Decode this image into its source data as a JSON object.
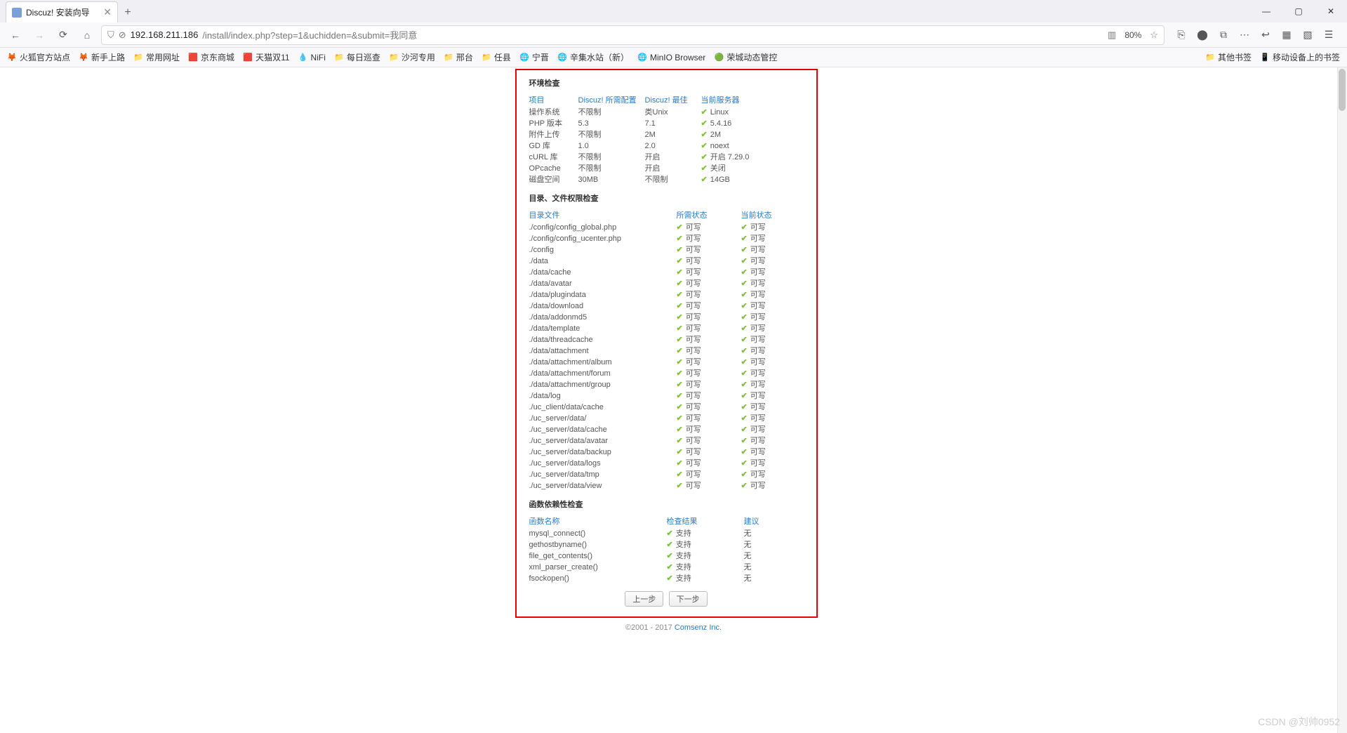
{
  "browser": {
    "tab_title": "Discuz! 安装向导",
    "newtab_icon": "+",
    "window_controls": {
      "min": "—",
      "max": "▢",
      "close": "✕"
    },
    "nav": {
      "back": "←",
      "forward": "→",
      "reload": "⟳",
      "home": "⌂"
    },
    "url_icons": {
      "shield": "⛉",
      "lock": "⊘"
    },
    "url_display_prefix": "192.168.211.186",
    "url_display_rest": "/install/index.php?step=1&uchidden=&submit=我同意",
    "zoom": "80%",
    "star_icon": "☆",
    "toolbar_icons": [
      "⎘",
      "⬤",
      "⧉",
      "⋯",
      "↩",
      "▦",
      "▧",
      "☰"
    ]
  },
  "bookmarks": {
    "items": [
      {
        "icon": "🦊",
        "label": "火狐官方站点"
      },
      {
        "icon": "🦊",
        "label": "新手上路"
      },
      {
        "icon": "📁",
        "label": "常用网址"
      },
      {
        "icon": "🟥",
        "label": "京东商城"
      },
      {
        "icon": "🟥",
        "label": "天猫双11"
      },
      {
        "icon": "💧",
        "label": "NiFi"
      },
      {
        "icon": "📁",
        "label": "每日巡查"
      },
      {
        "icon": "📁",
        "label": "沙河专用"
      },
      {
        "icon": "📁",
        "label": "邢台"
      },
      {
        "icon": "📁",
        "label": "任县"
      },
      {
        "icon": "🌐",
        "label": "宁晋"
      },
      {
        "icon": "🌐",
        "label": "辛集水站（新）"
      },
      {
        "icon": "🌐",
        "label": "MinIO Browser"
      },
      {
        "icon": "🟢",
        "label": "荣城动态管控"
      }
    ],
    "right": [
      {
        "icon": "📁",
        "label": "其他书签"
      },
      {
        "icon": "📱",
        "label": "移动设备上的书签"
      }
    ]
  },
  "install": {
    "env_title": "环境检查",
    "env_headers": {
      "item": "项目",
      "min": "Discuz! 所需配置",
      "best": "Discuz! 最佳",
      "cur": "当前服务器"
    },
    "env_rows": [
      {
        "item": "操作系统",
        "min": "不限制",
        "best": "类Unix",
        "cur": "Linux"
      },
      {
        "item": "PHP 版本",
        "min": "5.3",
        "best": "7.1",
        "cur": "5.4.16"
      },
      {
        "item": "附件上传",
        "min": "不限制",
        "best": "2M",
        "cur": "2M"
      },
      {
        "item": "GD 库",
        "min": "1.0",
        "best": "2.0",
        "cur": "noext"
      },
      {
        "item": "cURL 库",
        "min": "不限制",
        "best": "开启",
        "cur": "开启 7.29.0"
      },
      {
        "item": "OPcache",
        "min": "不限制",
        "best": "开启",
        "cur": "关闭"
      },
      {
        "item": "磁盘空间",
        "min": "30MB",
        "best": "不限制",
        "cur": "14GB"
      }
    ],
    "perm_title": "目录、文件权限检查",
    "perm_headers": {
      "path": "目录文件",
      "need": "所需状态",
      "cur": "当前状态"
    },
    "perm_ok": "可写",
    "perm_rows": [
      "./config/config_global.php",
      "./config/config_ucenter.php",
      "./config",
      "./data",
      "./data/cache",
      "./data/avatar",
      "./data/plugindata",
      "./data/download",
      "./data/addonmd5",
      "./data/template",
      "./data/threadcache",
      "./data/attachment",
      "./data/attachment/album",
      "./data/attachment/forum",
      "./data/attachment/group",
      "./data/log",
      "./uc_client/data/cache",
      "./uc_server/data/",
      "./uc_server/data/cache",
      "./uc_server/data/avatar",
      "./uc_server/data/backup",
      "./uc_server/data/logs",
      "./uc_server/data/tmp",
      "./uc_server/data/view"
    ],
    "func_title": "函数依赖性检查",
    "func_headers": {
      "name": "函数名称",
      "result": "检查结果",
      "advice": "建议"
    },
    "func_ok": "支持",
    "func_none": "无",
    "func_rows": [
      "mysql_connect()",
      "gethostbyname()",
      "file_get_contents()",
      "xml_parser_create()",
      "fsockopen()"
    ],
    "btn_prev": "上一步",
    "btn_next": "下一步"
  },
  "footer": {
    "copy": "©2001 - 2017 ",
    "link": "Comsenz Inc."
  },
  "watermark": "CSDN @刘帅0952"
}
